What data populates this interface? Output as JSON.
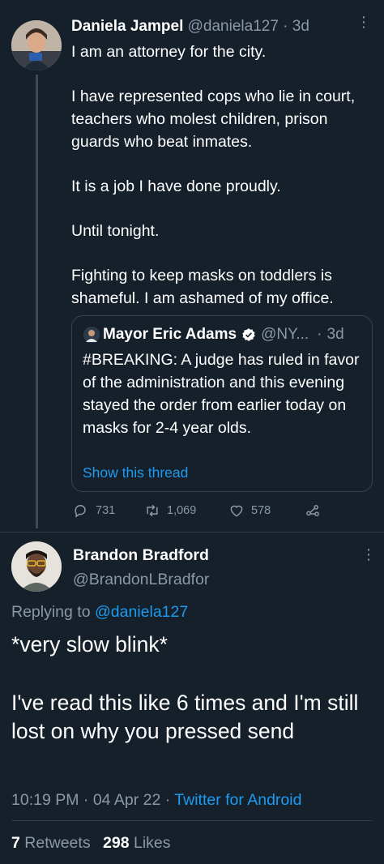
{
  "tweet": {
    "author_name": "Daniela Jampel",
    "author_handle": "@daniela127",
    "separator": "·",
    "time_ago": "3d",
    "more": "⋮",
    "paragraphs": [
      "I am an attorney for the city.",
      "I have represented cops who lie in court, teachers who molest children, prison guards who beat inmates.",
      "It is a job I have done proudly.",
      "Until tonight.",
      "Fighting to keep masks on toddlers is shameful. I am ashamed of my office."
    ],
    "quote": {
      "author_name": "Mayor Eric Adams",
      "author_handle": "@NY...",
      "separator": "·",
      "time_ago": "3d",
      "text": "#BREAKING: A judge has ruled in favor of the administration and this evening stayed the order from earlier today on masks for 2-4 year olds.",
      "show_thread": "Show this thread"
    },
    "actions": {
      "replies": "731",
      "retweets": "1,069",
      "likes": "578",
      "reply_icon": "reply-icon",
      "retweet_icon": "retweet-icon",
      "like_icon": "heart-icon",
      "share_icon": "share-icon"
    }
  },
  "reply": {
    "author_name": "Brandon Bradford",
    "author_handle": "@BrandonLBradfor",
    "more": "⋮",
    "replying_prefix": "Replying to",
    "replying_to": "@daniela127",
    "lines": [
      "*very slow blink*",
      "I've read this like 6 times and I'm still lost on why you pressed send"
    ],
    "time": "10:19 PM",
    "date": "04 Apr 22",
    "separator": "·",
    "source": "Twitter for Android",
    "retweets_count": "7",
    "retweets_label": "Retweets",
    "likes_count": "298",
    "likes_label": "Likes"
  },
  "colors": {
    "background": "#15202b",
    "accent": "#1d9bf0",
    "muted": "#8b98a5",
    "border": "#38444d"
  }
}
